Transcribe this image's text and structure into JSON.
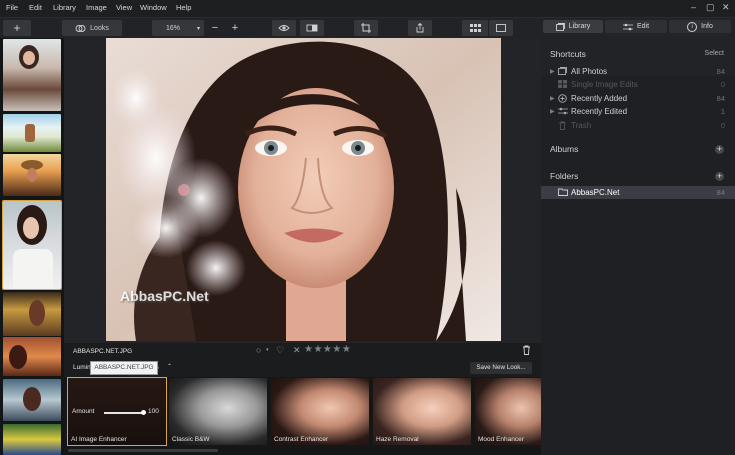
{
  "menu": [
    "File",
    "Edit",
    "Library",
    "Image",
    "View",
    "Window",
    "Help"
  ],
  "toolbar": {
    "looks_label": "Looks",
    "zoom_value": "16%"
  },
  "right_tabs": {
    "library": "Library",
    "edit": "Edit",
    "info": "Info"
  },
  "shortcuts": {
    "title": "Shortcuts",
    "select_label": "Select",
    "items": [
      {
        "label": "All Photos",
        "count": "84"
      },
      {
        "label": "Single Image Edits",
        "count": "0"
      },
      {
        "label": "Recently Added",
        "count": "84"
      },
      {
        "label": "Recently Edited",
        "count": "1"
      },
      {
        "label": "Trash",
        "count": "0"
      }
    ]
  },
  "albums": {
    "title": "Albums"
  },
  "folders": {
    "title": "Folders",
    "items": [
      {
        "label": "AbbasPC.Net",
        "count": "84"
      }
    ]
  },
  "photo": {
    "filename": "ABBASPC.NET.JPG",
    "watermark": "AbbasPC.Net"
  },
  "looks": {
    "category_prefix": "Lumin",
    "category_suffix": "ls",
    "tooltip": "ABBASPC.NET.JPG",
    "save_label": "Save New Look...",
    "amount_label": "Amount",
    "amount_value": "100",
    "presets": [
      "AI Image Enhancer",
      "Classic B&W",
      "Contrast Enhancer",
      "Haze Removal",
      "Mood Enhancer"
    ]
  },
  "colors": {
    "accent": "#d8a640",
    "selected_row": "#3a3d44"
  }
}
